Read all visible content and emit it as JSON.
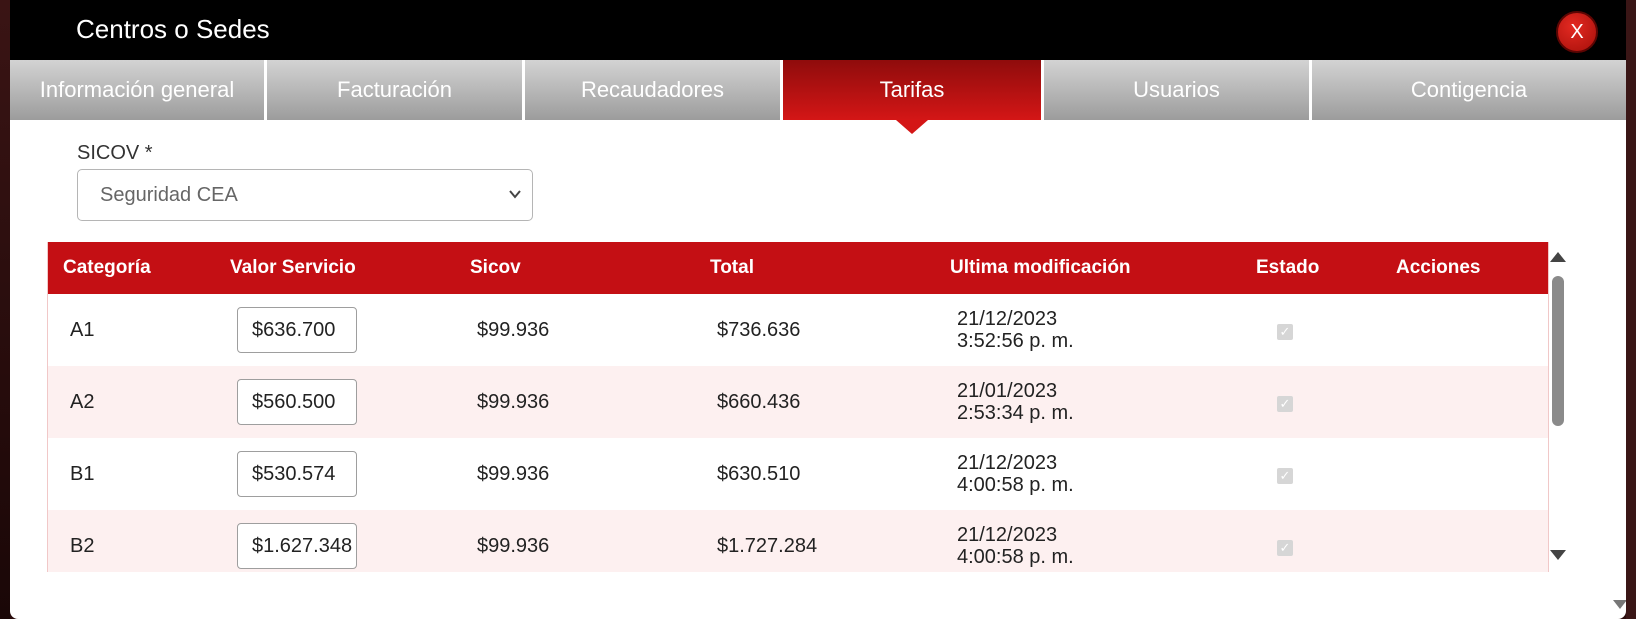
{
  "modal": {
    "title": "Centros o Sedes",
    "close_label": "X"
  },
  "tabs": [
    {
      "label": "Información general",
      "active": false
    },
    {
      "label": "Facturación",
      "active": false
    },
    {
      "label": "Recaudadores",
      "active": false
    },
    {
      "label": "Tarifas",
      "active": true
    },
    {
      "label": "Usuarios",
      "active": false
    },
    {
      "label": "Contigencia",
      "active": false
    }
  ],
  "sicov": {
    "label": "SICOV *",
    "selected": "Seguridad CEA",
    "icon": "chevron-down-icon"
  },
  "table": {
    "columns": [
      "Categoría",
      "Valor Servicio",
      "Sicov",
      "Total",
      "Ultima modificación",
      "Estado",
      "Acciones"
    ],
    "rows": [
      {
        "categoria": "A1",
        "valor": "$636.700",
        "sicov": "$99.936",
        "total": "$736.636",
        "fecha": "21/12/2023",
        "hora": "3:52:56 p. m.",
        "estado": true
      },
      {
        "categoria": "A2",
        "valor": "$560.500",
        "sicov": "$99.936",
        "total": "$660.436",
        "fecha": "21/01/2023",
        "hora": "2:53:34 p. m.",
        "estado": true
      },
      {
        "categoria": "B1",
        "valor": "$530.574",
        "sicov": "$99.936",
        "total": "$630.510",
        "fecha": "21/12/2023",
        "hora": "4:00:58 p. m.",
        "estado": true
      },
      {
        "categoria": "B2",
        "valor": "$1.627.348",
        "sicov": "$99.936",
        "total": "$1.727.284",
        "fecha": "21/12/2023",
        "hora": "4:00:58 p. m.",
        "estado": true
      }
    ]
  },
  "colors": {
    "header_black": "#000000",
    "accent_red": "#c40f14",
    "tab_gray": "#a8a8a8",
    "row_alt": "#fdf0f0"
  }
}
